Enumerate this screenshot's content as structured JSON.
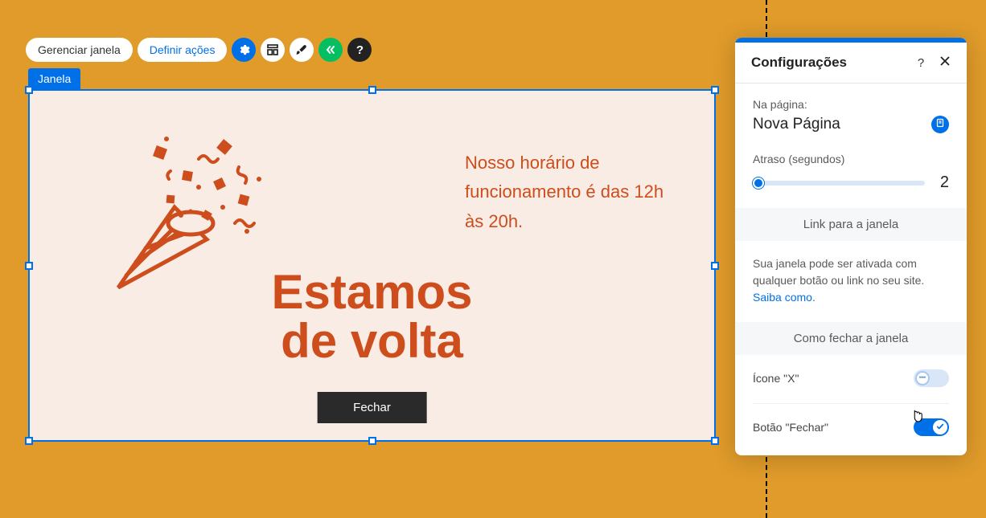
{
  "toolbar": {
    "manage_label": "Gerenciar janela",
    "define_actions_label": "Definir ações"
  },
  "element_tag": "Janela",
  "popup": {
    "hours_text": "Nosso horário de funcionamento é das 12h às 20h.",
    "title_line1": "Estamos",
    "title_line2": "de volta",
    "close_button_label": "Fechar"
  },
  "settings": {
    "title": "Configurações",
    "on_page_label": "Na página:",
    "page_name": "Nova Página",
    "delay_label": "Atraso (segundos)",
    "delay_value": "2",
    "link_section_heading": "Link para a janela",
    "link_desc": "Sua janela pode ser ativada com qualquer botão ou link no seu site.",
    "link_learn": "Saiba como",
    "close_section_heading": "Como fechar a janela",
    "x_icon_label": "Ícone \"X\"",
    "close_btn_label": "Botão \"Fechar\""
  },
  "colors": {
    "accent": "#0070e8",
    "brand_orange": "#cd4d1c",
    "bg": "#e09b2a"
  }
}
